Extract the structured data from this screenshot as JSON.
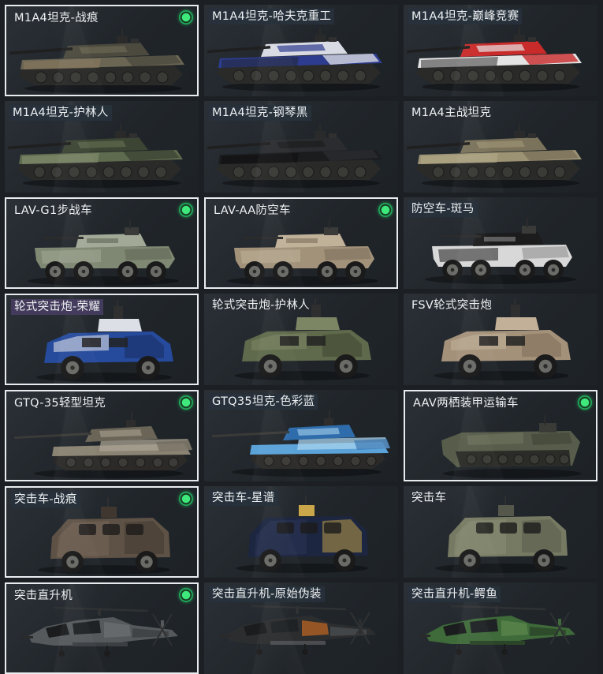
{
  "colors": {
    "background": "#1c2024",
    "card": "#23292e",
    "selected_border": "#e9ecef",
    "equipped_dot": "#2fd46c"
  },
  "cards": [
    {
      "name": "M1A4坦克-战痕",
      "type": "tank",
      "selected": true,
      "equipped": true,
      "label_highlight": false,
      "colors": [
        "#6b6654",
        "#4c4a3e",
        "#8d7a5e"
      ]
    },
    {
      "name": "M1A4坦克-哈夫克重工",
      "type": "tank",
      "selected": false,
      "equipped": false,
      "label_highlight": true,
      "colors": [
        "#2d3c8e",
        "#d8dbe3",
        "#232733"
      ]
    },
    {
      "name": "M1A4坦克-巅峰竞赛",
      "type": "tank",
      "selected": false,
      "equipped": false,
      "label_highlight": true,
      "colors": [
        "#e4e4e4",
        "#c92a2a",
        "#333333"
      ]
    },
    {
      "name": "M1A4坦克-护林人",
      "type": "tank",
      "selected": false,
      "equipped": false,
      "label_highlight": true,
      "colors": [
        "#5e6b4e",
        "#3c4533",
        "#8a9474"
      ]
    },
    {
      "name": "M1A4坦克-钢琴黑",
      "type": "tank",
      "selected": false,
      "equipped": false,
      "label_highlight": true,
      "colors": [
        "#1b1c1e",
        "#2b2c2f",
        "#0f0f10"
      ]
    },
    {
      "name": "M1A4主战坦克",
      "type": "tank",
      "selected": false,
      "equipped": false,
      "label_highlight": false,
      "colors": [
        "#9c9274",
        "#7a725a",
        "#b5ab8b"
      ]
    },
    {
      "name": "LAV-G1步战车",
      "type": "apc",
      "selected": true,
      "equipped": true,
      "label_highlight": false,
      "colors": [
        "#7f8872",
        "#a2a997",
        "#5e6655"
      ]
    },
    {
      "name": "LAV-AA防空车",
      "type": "apc",
      "selected": true,
      "equipped": true,
      "label_highlight": false,
      "colors": [
        "#a2927a",
        "#c0b199",
        "#7b6e5b"
      ]
    },
    {
      "name": "防空车-斑马",
      "type": "apc",
      "selected": false,
      "equipped": false,
      "label_highlight": true,
      "colors": [
        "#d8d8d8",
        "#1c1c1c",
        "#8a8a8a"
      ]
    },
    {
      "name": "轮式突击炮-荣耀",
      "type": "armored_car",
      "selected": true,
      "equipped": false,
      "label_highlight": true,
      "label_style": "lav",
      "colors": [
        "#264a9c",
        "#dcdfe6",
        "#1a2d5e"
      ]
    },
    {
      "name": "轮式突击炮-护林人",
      "type": "armored_car",
      "selected": false,
      "equipped": false,
      "label_highlight": false,
      "colors": [
        "#5f6a4c",
        "#7c8564",
        "#3e4532"
      ]
    },
    {
      "name": "FSV轮式突击炮",
      "type": "armored_car",
      "selected": false,
      "equipped": false,
      "label_highlight": false,
      "colors": [
        "#a4917a",
        "#c2b198",
        "#7d6d5a"
      ]
    },
    {
      "name": "GTQ-35轻型坦克",
      "type": "light_tank",
      "selected": true,
      "equipped": true,
      "label_highlight": false,
      "colors": [
        "#8a8373",
        "#6b6558",
        "#a9a291"
      ]
    },
    {
      "name": "GTQ35坦克-色彩蓝",
      "type": "light_tank",
      "selected": false,
      "equipped": false,
      "label_highlight": true,
      "colors": [
        "#5aa2d8",
        "#2f6cab",
        "#a9d3ee"
      ]
    },
    {
      "name": "AAV两栖装甲运输车",
      "type": "amphibious",
      "selected": true,
      "equipped": true,
      "label_highlight": false,
      "colors": [
        "#575d4a",
        "#6f7560",
        "#3e4236"
      ]
    },
    {
      "name": "突击车-战痕",
      "type": "mrap",
      "selected": true,
      "equipped": true,
      "label_highlight": true,
      "colors": [
        "#5e5145",
        "#7a6a5a",
        "#403830"
      ]
    },
    {
      "name": "突击车-星谱",
      "type": "mrap",
      "selected": false,
      "equipped": false,
      "label_highlight": true,
      "colors": [
        "#1d2640",
        "#2e3a5c",
        "#c9a64a"
      ]
    },
    {
      "name": "突击车",
      "type": "mrap",
      "selected": false,
      "equipped": false,
      "label_highlight": false,
      "colors": [
        "#777a62",
        "#8f917a",
        "#55574a"
      ]
    },
    {
      "name": "突击直升机",
      "type": "helicopter",
      "selected": true,
      "equipped": true,
      "label_highlight": false,
      "colors": [
        "#55595c",
        "#6d7174",
        "#3c3f42"
      ]
    },
    {
      "name": "突击直升机-原始伪装",
      "type": "helicopter",
      "selected": false,
      "equipped": false,
      "label_highlight": true,
      "colors": [
        "#2c2d2f",
        "#c2661f",
        "#4a4c4f"
      ]
    },
    {
      "name": "突击直升机-鳄鱼",
      "type": "helicopter",
      "selected": false,
      "equipped": false,
      "label_highlight": true,
      "colors": [
        "#3f6a3a",
        "#5e8a4e",
        "#2b4528"
      ]
    }
  ]
}
